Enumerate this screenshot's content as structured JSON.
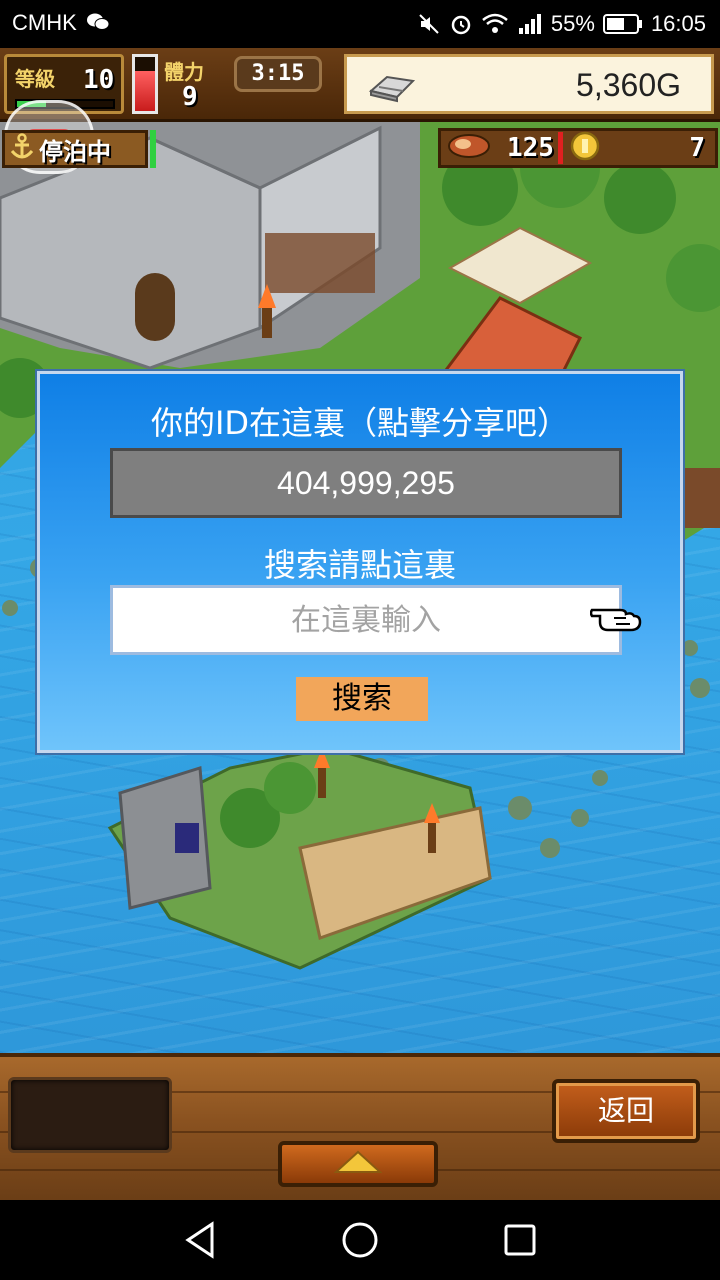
{
  "status_bar": {
    "carrier": "CMHK",
    "battery": "55%",
    "time": "16:05",
    "icons": [
      "wechat-icon",
      "mute-icon",
      "alarm-icon",
      "wifi-icon",
      "signal-icon",
      "battery-icon"
    ]
  },
  "hud": {
    "level_label": "等級",
    "level_value": "10",
    "level_progress": 0.3,
    "stamina_label": "體力",
    "stamina_value": "9",
    "stamina_fill": 0.75,
    "timer": "3:15",
    "gold": "5,360G",
    "anchor_status": "停泊中",
    "meat": "125",
    "coins": "7"
  },
  "dialog": {
    "title": "你的ID在這裏（點擊分享吧）",
    "id_value": "404,999,295",
    "search_label": "搜索請點這裏",
    "search_placeholder": "在這裏輸入",
    "search_button": "搜索"
  },
  "bottom_bar": {
    "back_button": "返回"
  },
  "colors": {
    "dialog_top": "#0f7fe6",
    "dialog_bottom": "#6fc4fb",
    "id_box": "#7f7f7f",
    "search_button": "#f2a65a",
    "sea": "#34a7e6",
    "wood": "#8a5220"
  }
}
